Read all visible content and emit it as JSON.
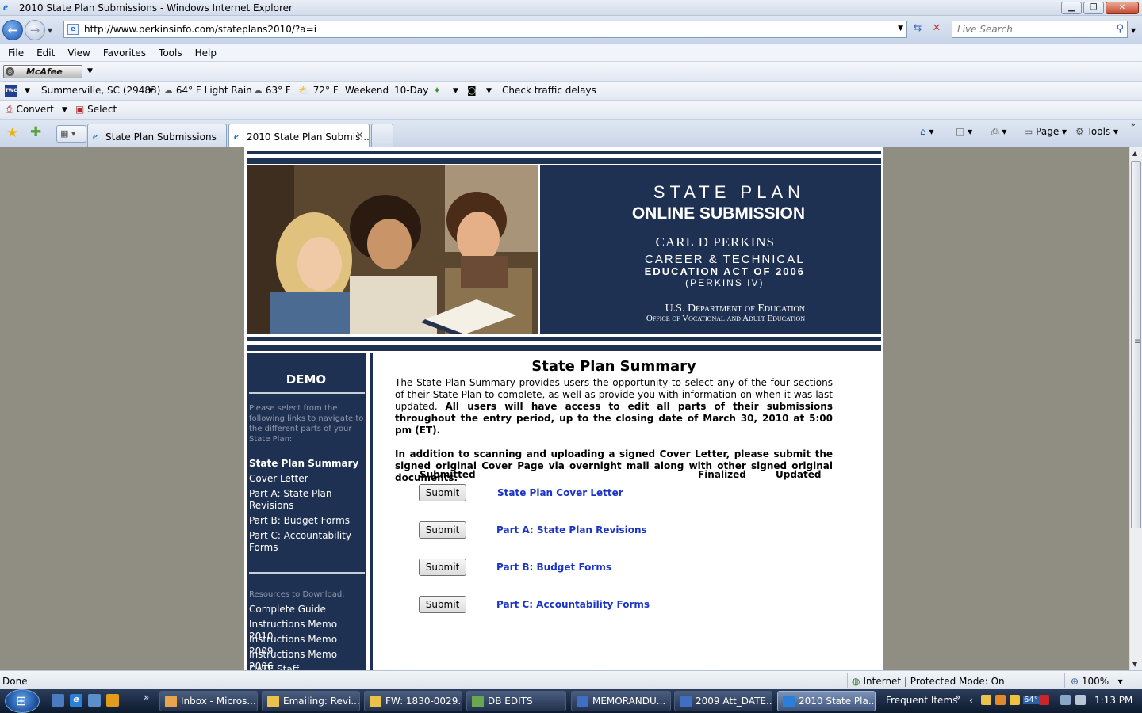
{
  "window": {
    "title": "2010 State Plan Submissions - Windows Internet Explorer"
  },
  "address": {
    "url": "http://www.perkinsinfo.com/stateplans2010/?a=i",
    "search_placeholder": "Live Search"
  },
  "menu": [
    "File",
    "Edit",
    "View",
    "Favorites",
    "Tools",
    "Help"
  ],
  "toolbar_mcafee": {
    "label": "McAfee"
  },
  "weather": {
    "location": "Summerville, SC (29483)",
    "current": "64° F Light Rain",
    "temp2": "63° F",
    "temp3": "72° F",
    "weekend": "Weekend",
    "tenday": "10-Day",
    "traffic": "Check traffic delays"
  },
  "pdf_toolbar": {
    "convert": "Convert",
    "select": "Select"
  },
  "tabs": [
    {
      "label": "State Plan Submissions"
    },
    {
      "label": "2010 State Plan Submis..."
    }
  ],
  "commandbar": {
    "page": "Page",
    "tools": "Tools"
  },
  "banner": {
    "line1": "STATE PLAN",
    "line2": "ONLINE SUBMISSION",
    "line3": "CARL D PERKINS",
    "line4a": "CAREER & TECHNICAL",
    "line4b": "EDUCATION ACT OF 2006",
    "line4c": "(PERKINS IV)",
    "line5a": "U.S. Department of Education",
    "line5b": "Office of Vocational and Adult Education"
  },
  "sidebar": {
    "title": "DEMO",
    "help": "Please select from the following links to navigate to the different parts of your State Plan:",
    "links": [
      "State Plan Summary",
      "Cover Letter",
      "Part A: State Plan Revisions",
      "Part B: Budget Forms",
      "Part C: Accountability Forms"
    ],
    "resources_label": "Resources to Download:",
    "resources": [
      "Complete Guide",
      "Instructions Memo 2010",
      "Instructions Memo 2009",
      "Instructions Memo 2006",
      "DATE Staff"
    ]
  },
  "main": {
    "heading": "State Plan Summary",
    "para1_normal": "The State Plan Summary provides users the opportunity to select any of the four sections of their State Plan to complete, as well as provide you with information on when it was last updated. ",
    "para1_bold": "All users will have access to edit all parts of their submissions throughout the entry period, up to the closing date of March 30, 2010 at 5:00 pm (ET).",
    "para2": "In addition to scanning and uploading a signed Cover Letter, please submit the signed original Cover Page via overnight mail along with other signed original documents.",
    "col_submitted": "Submitted",
    "col_finalized": "Finalized",
    "col_updated": "Updated",
    "submit_label": "Submit",
    "rows": [
      "State Plan Cover Letter",
      "Part A: State Plan Revisions",
      "Part B: Budget Forms",
      "Part C: Accountability Forms"
    ]
  },
  "status": {
    "left": "Done",
    "zone": "Internet | Protected Mode: On",
    "zoom": "100%"
  },
  "taskbar": {
    "items": [
      "Inbox - Micros...",
      "Emailing: Revi...",
      "FW: 1830-0029...",
      "DB EDITS",
      "MEMORANDU...",
      "2009 Att_DATE...",
      "2010 State Pla..."
    ],
    "frequent": "Frequent Items",
    "temp": "64°",
    "time": "1:13 PM"
  }
}
